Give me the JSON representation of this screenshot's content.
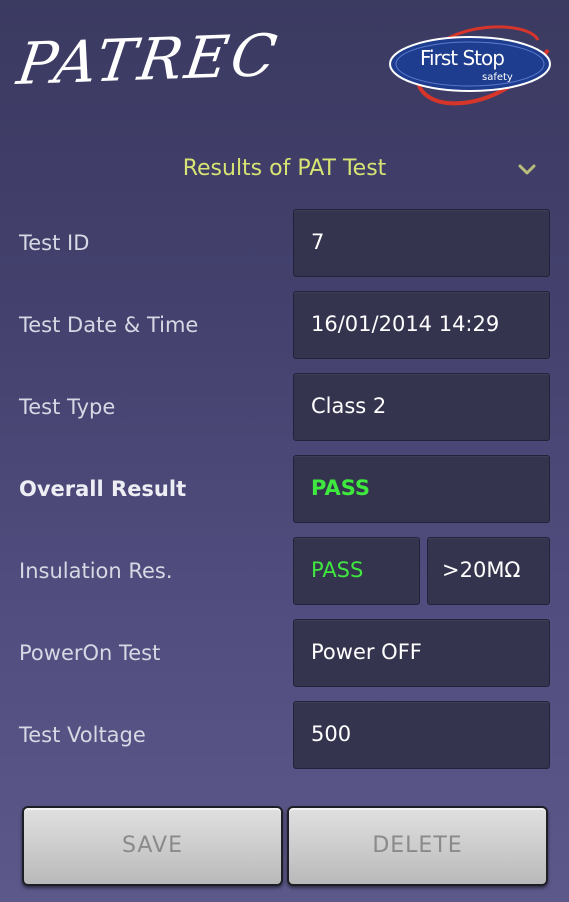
{
  "header": {
    "app_logo": "PATREC",
    "brand_name": "First Stop",
    "brand_sub": "safety"
  },
  "results": {
    "title": "Results of PAT Test"
  },
  "fields": {
    "test_id": {
      "label": "Test ID",
      "value": "7"
    },
    "test_datetime": {
      "label": "Test Date & Time",
      "value": "16/01/2014 14:29"
    },
    "test_type": {
      "label": "Test Type",
      "value": "Class 2"
    },
    "overall_result": {
      "label": "Overall Result",
      "value": "PASS"
    },
    "insulation_res": {
      "label": "Insulation Res.",
      "result": "PASS",
      "reading": ">20MΩ"
    },
    "poweron_test": {
      "label": "PowerOn Test",
      "value": "Power OFF"
    },
    "test_voltage": {
      "label": "Test Voltage",
      "value": "500"
    }
  },
  "actions": {
    "save_label": "SAVE",
    "delete_label": "DELETE"
  },
  "colors": {
    "title_accent": "#d7e373",
    "pass_green": "#3ee83e",
    "field_bg": "#35344e"
  }
}
